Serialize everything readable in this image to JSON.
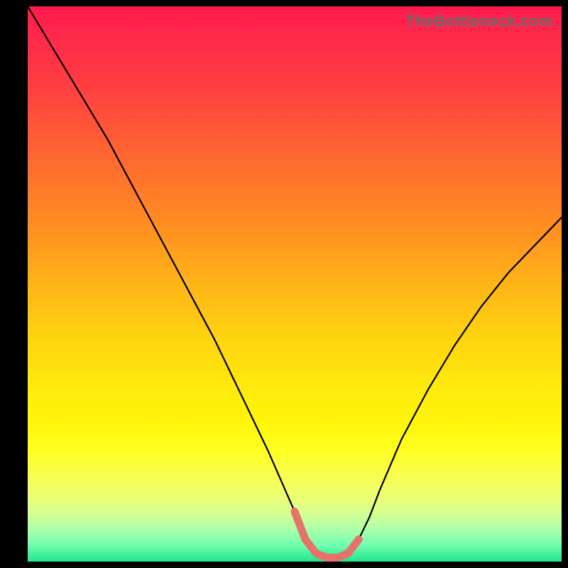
{
  "watermark": "TheBottleneck.com",
  "chart_data": {
    "type": "line",
    "title": "",
    "xlabel": "",
    "ylabel": "",
    "xlim": [
      0,
      100
    ],
    "ylim": [
      0,
      100
    ],
    "grid": false,
    "legend": false,
    "series": [
      {
        "name": "bottleneck-curve",
        "x": [
          0,
          5,
          10,
          15,
          20,
          25,
          30,
          35,
          40,
          45,
          50,
          52,
          54,
          56,
          58,
          60,
          62,
          64,
          66,
          70,
          75,
          80,
          85,
          90,
          95,
          100
        ],
        "values": [
          100,
          92,
          84,
          76,
          67,
          58,
          49,
          40,
          30,
          20,
          9,
          4,
          1.5,
          0.7,
          0.7,
          1.5,
          4,
          8,
          13,
          22,
          31,
          39,
          46,
          52,
          57,
          62
        ]
      }
    ],
    "highlight": {
      "name": "min-segment",
      "color": "#e6736b",
      "x": [
        50,
        52,
        54,
        56,
        58,
        60,
        62
      ],
      "values": [
        9,
        4,
        1.5,
        0.7,
        0.7,
        1.5,
        4
      ]
    },
    "gradient_stops": [
      {
        "pos": 0,
        "color": "#ff1a4d"
      },
      {
        "pos": 15,
        "color": "#ff4040"
      },
      {
        "pos": 40,
        "color": "#ff9020"
      },
      {
        "pos": 60,
        "color": "#ffd410"
      },
      {
        "pos": 80,
        "color": "#feff20"
      },
      {
        "pos": 94,
        "color": "#b0ffa8"
      },
      {
        "pos": 100,
        "color": "#20e58a"
      }
    ]
  }
}
